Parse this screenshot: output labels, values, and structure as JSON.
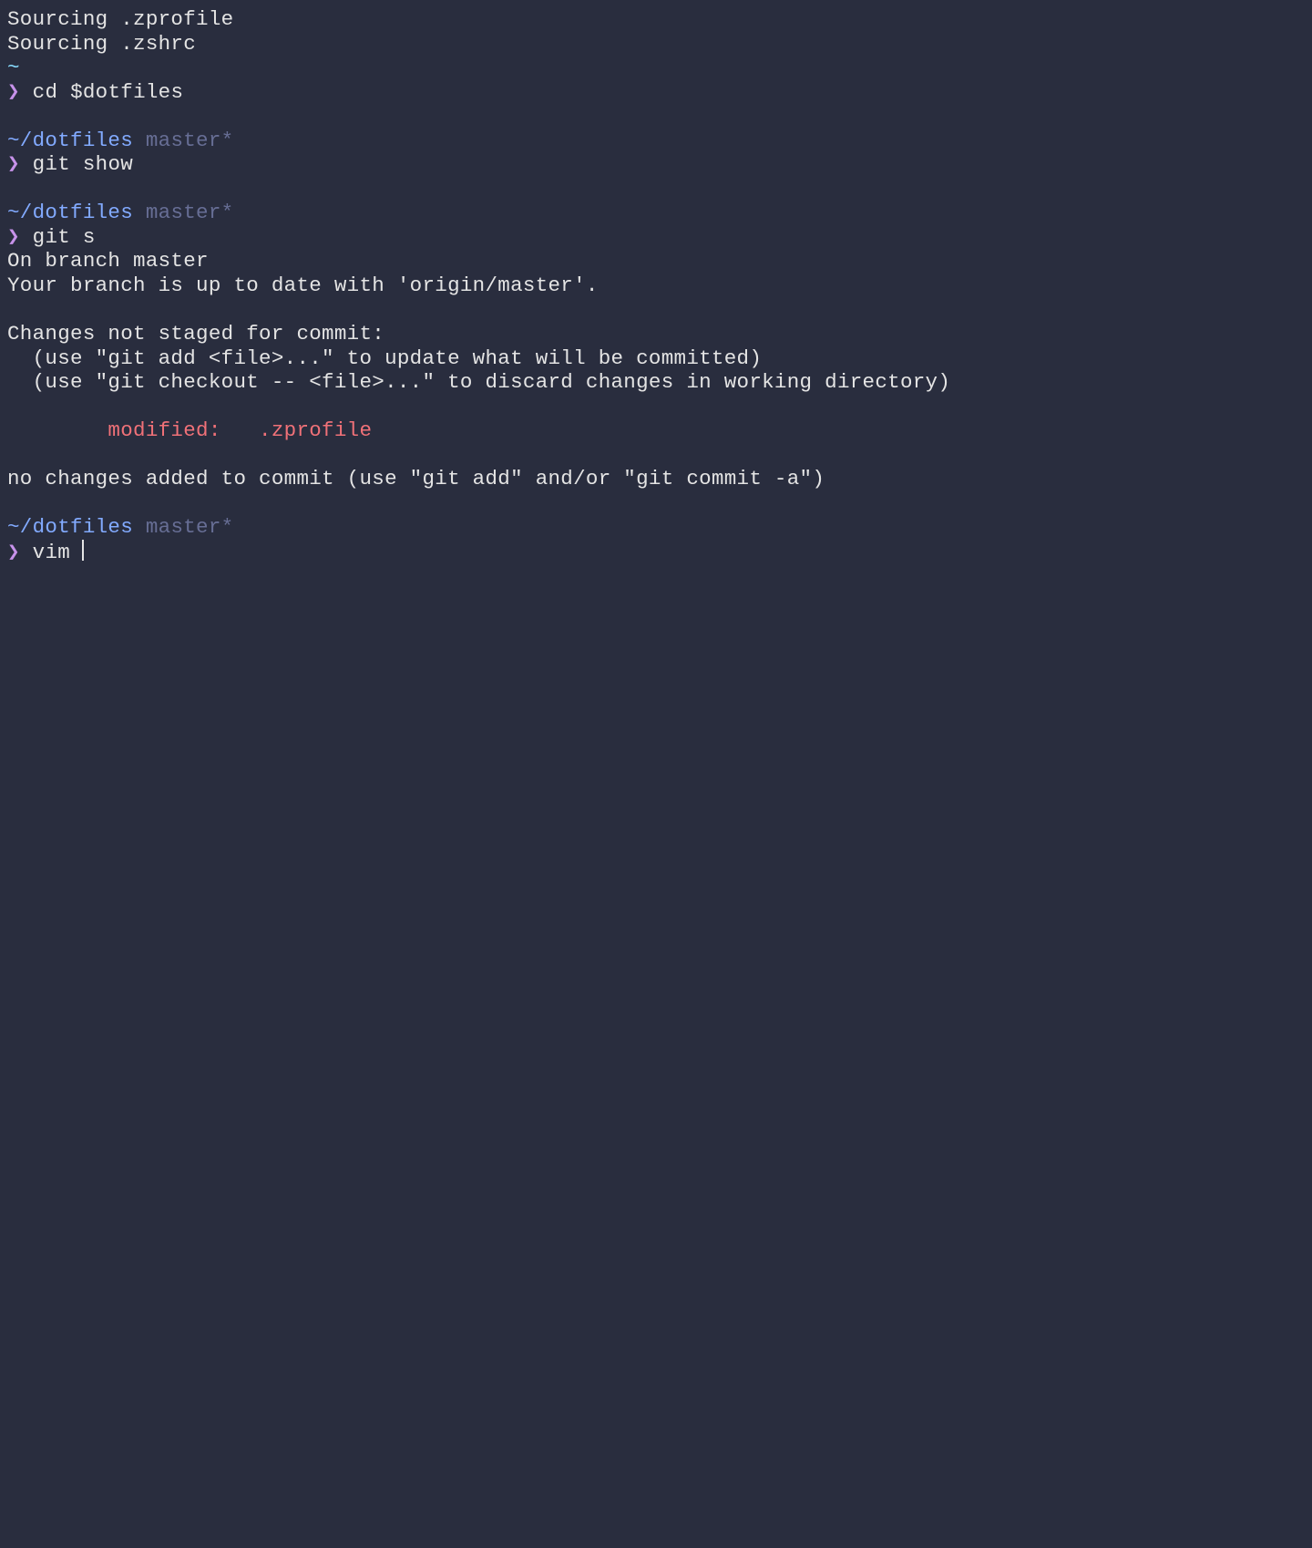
{
  "sourcing1": "Sourcing .zprofile",
  "sourcing2": "Sourcing .zshrc",
  "tilde": "~",
  "prompt_char": "❯",
  "cmd1": " cd $dotfiles",
  "path1": "~/dotfiles",
  "branch1": " master*",
  "cmd2": " git show",
  "path2": "~/dotfiles",
  "branch2": " master*",
  "cmd3": " git s",
  "status_branch": "On branch master",
  "status_upstream": "Your branch is up to date with 'origin/master'.",
  "status_notstaged": "Changes not staged for commit:",
  "status_hint1": "  (use \"git add <file>...\" to update what will be committed)",
  "status_hint2": "  (use \"git checkout -- <file>...\" to discard changes in working directory)",
  "status_modified": "        modified:   .zprofile",
  "status_nochanges": "no changes added to commit (use \"git add\" and/or \"git commit -a\")",
  "path3": "~/dotfiles",
  "branch3": " master*",
  "cmd4": " vim "
}
